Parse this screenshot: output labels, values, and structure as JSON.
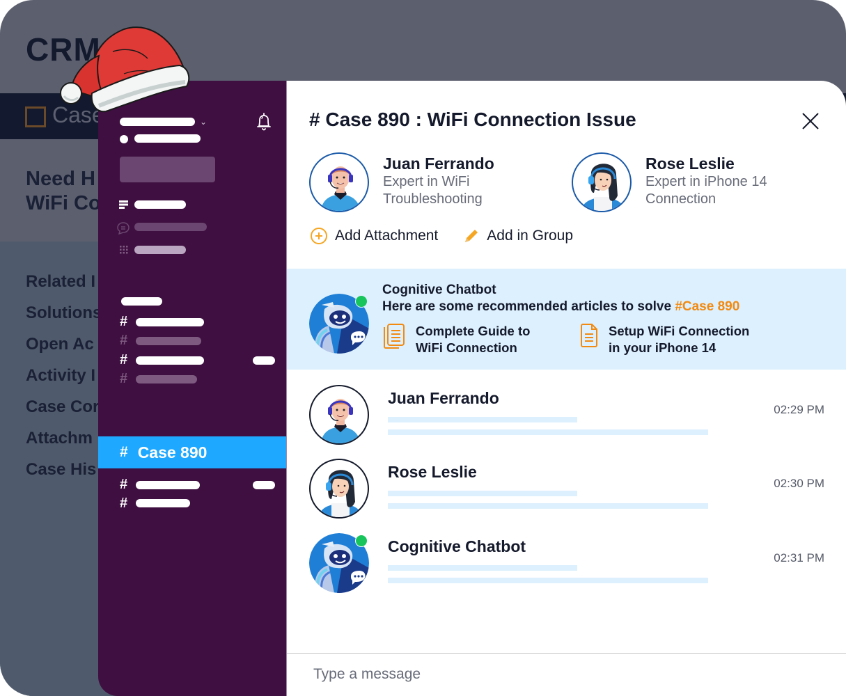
{
  "crm": {
    "title": "CRM",
    "tab_label": "Case",
    "heading_line1": "Need H",
    "heading_line2": "WiFi Co",
    "menu": [
      "Related I",
      "Solutions",
      "Open Ac",
      "Activity I",
      "Case Cor",
      "Attachm",
      "Case His"
    ]
  },
  "sidebar": {
    "active_channel": {
      "hash": "#",
      "label": "Case 890"
    },
    "hash_symbol": "#",
    "accent_color": "#1fa8ff",
    "background_color": "#3e0f40"
  },
  "conversation": {
    "title": "# Case 890 : WiFi Connection Issue",
    "agents": [
      {
        "name": "Juan Ferrando",
        "desc_line1": "Expert in WiFi",
        "desc_line2": "Troubleshooting"
      },
      {
        "name": "Rose Leslie",
        "desc_line1": "Expert in iPhone 14",
        "desc_line2": "Connection"
      }
    ],
    "actions": {
      "add_attachment": "Add Attachment",
      "add_in_group": "Add in Group"
    },
    "bot": {
      "name": "Cognitive Chatbot",
      "message_prefix": "Here are some recommended articles to solve ",
      "message_tag": "#Case 890",
      "tag_color": "#f28a11",
      "articles": [
        {
          "line1": "Complete Guide to",
          "line2": "WiFi Connection"
        },
        {
          "line1": "Setup WiFi Connection",
          "line2": "in your iPhone 14"
        }
      ]
    },
    "messages": [
      {
        "sender": "Juan Ferrando",
        "time": "02:29 PM"
      },
      {
        "sender": "Rose Leslie",
        "time": "02:30 PM"
      },
      {
        "sender": "Cognitive Chatbot",
        "time": "02:31 PM"
      }
    ],
    "composer": {
      "placeholder": "Type a message",
      "value": ""
    }
  }
}
